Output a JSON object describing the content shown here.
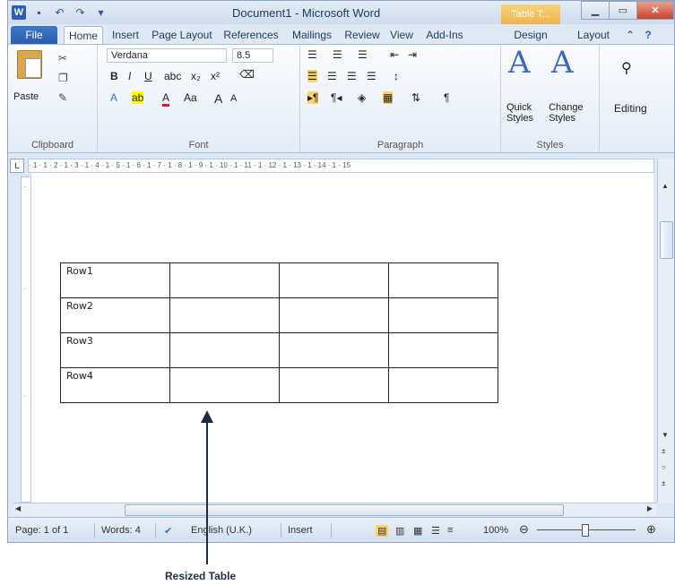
{
  "titlebar": {
    "document_title": "Document1 - Microsoft Word",
    "context_tab": "Table T...",
    "app_icon": "W"
  },
  "tabs": [
    {
      "label": "File"
    },
    {
      "label": "Home"
    },
    {
      "label": "Insert"
    },
    {
      "label": "Page Layout"
    },
    {
      "label": "References"
    },
    {
      "label": "Mailings"
    },
    {
      "label": "Review"
    },
    {
      "label": "View"
    },
    {
      "label": "Add-Ins"
    },
    {
      "label": "Design"
    },
    {
      "label": "Layout"
    }
  ],
  "ribbon": {
    "clipboard": {
      "paste_label": "Paste",
      "group_label": "Clipboard"
    },
    "font": {
      "font_name": "Verdana",
      "font_size": "8.5",
      "group_label": "Font",
      "bold": "B",
      "italic": "I",
      "underline": "U",
      "grow": "A",
      "shrink": "A",
      "change_case": "Aa"
    },
    "paragraph": {
      "group_label": "Paragraph",
      "pilcrow": "¶"
    },
    "styles": {
      "quick_styles": "Quick Styles",
      "change_styles": "Change Styles",
      "group_label": "Styles"
    },
    "editing": {
      "label": "Editing"
    }
  },
  "ruler": {
    "text": "· 1 · 1 · 2 · 1 · 3 · 1 · 4 · 1 · 5 · 1 · 6 · 1 · 7 · 1 · 8 · 1 · 9 · 1 · 10 · 1 · 11 · 1 · 12 · 1 · 13 · 1 · 14 · 1 · 15"
  },
  "table": {
    "rows": [
      [
        "Row1",
        "",
        "",
        ""
      ],
      [
        "Row2",
        "",
        "",
        ""
      ],
      [
        "Row3",
        "",
        "",
        ""
      ],
      [
        "Row4",
        "",
        "",
        ""
      ]
    ]
  },
  "statusbar": {
    "page": "Page: 1 of 1",
    "words": "Words: 4",
    "language": "English (U.K.)",
    "mode": "Insert",
    "zoom": "100%"
  },
  "annotation": {
    "caption": "Resized Table"
  },
  "colors": {
    "accent": "#2b5eb8",
    "context_tab": "#f0b44c",
    "close": "#c9442a"
  }
}
